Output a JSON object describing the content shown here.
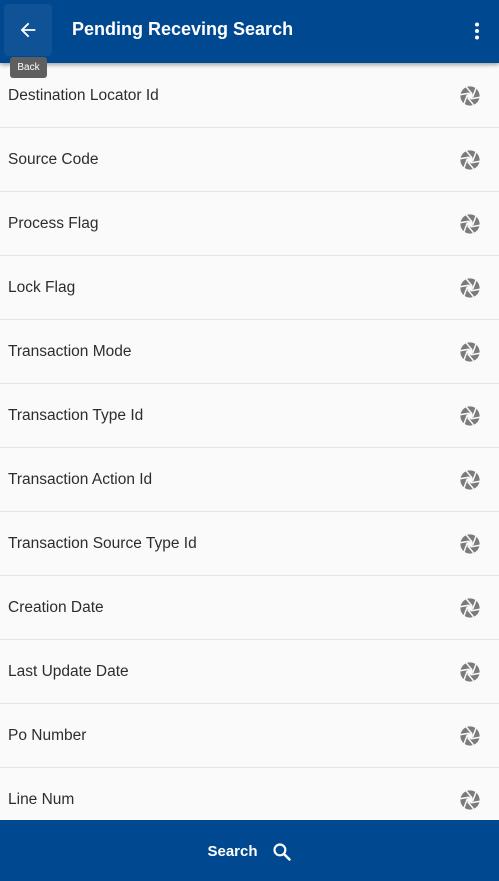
{
  "header": {
    "title": "Pending Receving Search",
    "back_icon": "arrow-left-icon",
    "menu_icon": "more-vertical-icon",
    "back_tooltip": "Back"
  },
  "fields": [
    {
      "label": "Destination Locator Id",
      "icon": "aperture-icon"
    },
    {
      "label": "Source Code",
      "icon": "aperture-icon"
    },
    {
      "label": "Process Flag",
      "icon": "aperture-icon"
    },
    {
      "label": "Lock Flag",
      "icon": "aperture-icon"
    },
    {
      "label": "Transaction Mode",
      "icon": "aperture-icon"
    },
    {
      "label": "Transaction Type Id",
      "icon": "aperture-icon"
    },
    {
      "label": "Transaction Action Id",
      "icon": "aperture-icon"
    },
    {
      "label": "Transaction Source Type Id",
      "icon": "aperture-icon"
    },
    {
      "label": "Creation Date",
      "icon": "aperture-icon"
    },
    {
      "label": "Last Update Date",
      "icon": "aperture-icon"
    },
    {
      "label": "Po Number",
      "icon": "aperture-icon"
    },
    {
      "label": "Line Num",
      "icon": "aperture-icon"
    }
  ],
  "footer": {
    "search_label": "Search",
    "search_icon": "search-icon"
  },
  "colors": {
    "primary": "#004990",
    "background": "#fafafa",
    "icon_gray": "#7b7b7b"
  }
}
